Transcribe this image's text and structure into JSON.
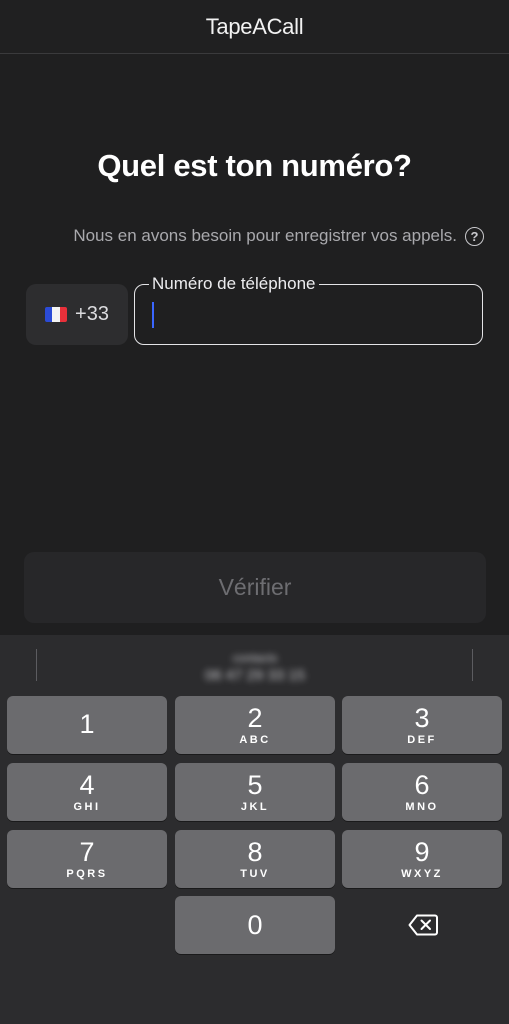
{
  "header": {
    "title": "TapeACall"
  },
  "main": {
    "question": "Quel est ton numéro?",
    "subtitle": "Nous en avons besoin pour enregistrer vos appels.",
    "help_icon": "?",
    "country": {
      "flag_icon": "france-flag-icon",
      "dial_code": "+33"
    },
    "phone_field": {
      "label": "Numéro de téléphone",
      "value": "",
      "placeholder": ""
    },
    "verify_button": "Vérifier"
  },
  "keyboard": {
    "suggestion": {
      "name": "contacts",
      "number": "06 47 29 33 15",
      "blurred": true
    },
    "keys": [
      {
        "num": "1",
        "letters": ""
      },
      {
        "num": "2",
        "letters": "ABC"
      },
      {
        "num": "3",
        "letters": "DEF"
      },
      {
        "num": "4",
        "letters": "GHI"
      },
      {
        "num": "5",
        "letters": "JKL"
      },
      {
        "num": "6",
        "letters": "MNO"
      },
      {
        "num": "7",
        "letters": "PQRS"
      },
      {
        "num": "8",
        "letters": "TUV"
      },
      {
        "num": "9",
        "letters": "WXYZ"
      },
      {
        "num": "0",
        "letters": ""
      }
    ],
    "delete_icon": "backspace-icon"
  },
  "colors": {
    "background": "#1f1f20",
    "keyboard_background": "#2c2c2e",
    "key": "#6b6b6e",
    "caret": "#3a66ff",
    "disabled_text": "#6d6d71"
  }
}
